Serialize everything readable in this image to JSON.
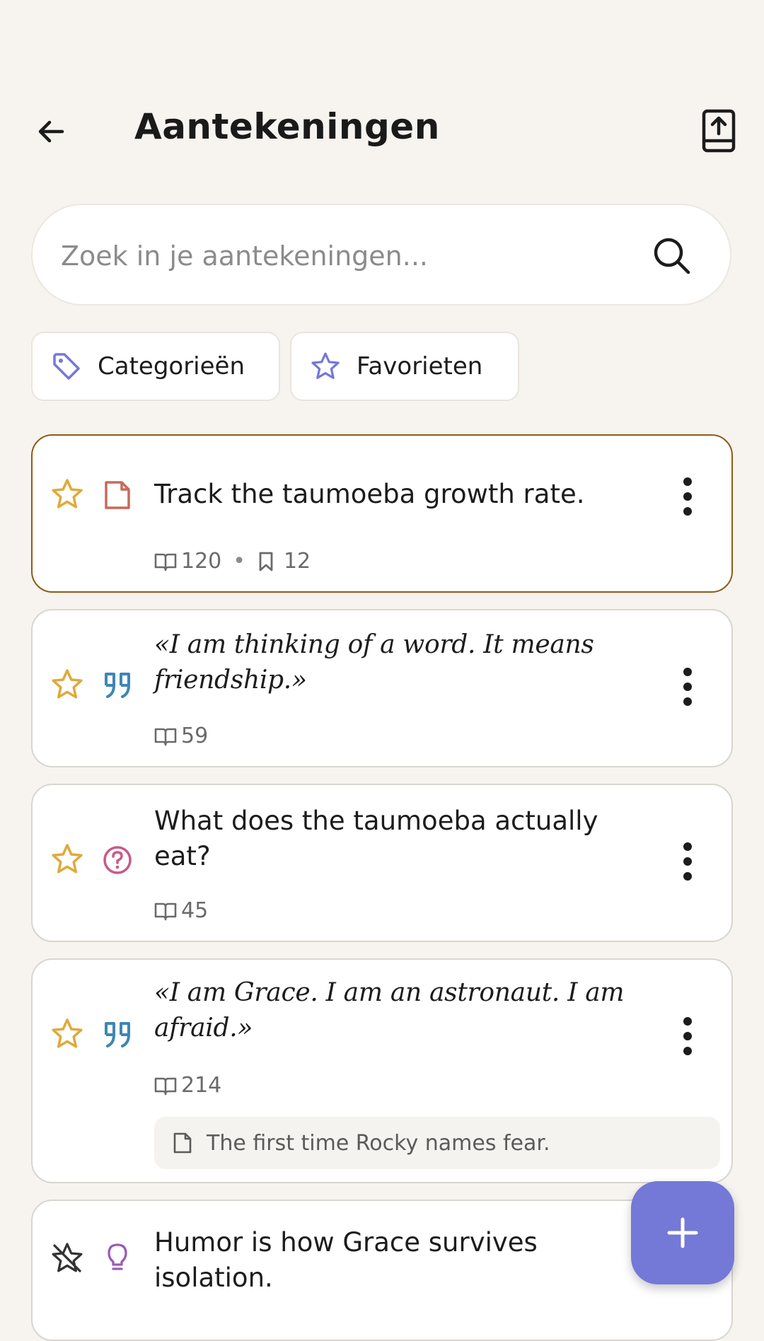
{
  "header": {
    "title": "Aantekeningen",
    "back_icon": "arrow-left-icon",
    "export_icon": "book-upload-icon"
  },
  "search": {
    "placeholder": "Zoek in je aantekeningen...",
    "value": "",
    "icon": "search-icon"
  },
  "filters": [
    {
      "label": "Categorieën",
      "icon": "tag-icon",
      "icon_color": "#7478d7"
    },
    {
      "label": "Favorieten",
      "icon": "star-outline-icon",
      "icon_color": "#7478d7"
    }
  ],
  "notes": [
    {
      "type": "note",
      "type_color": "#c96a5a",
      "favorite": true,
      "text": "Track the taumoeba growth rate.",
      "page": "120",
      "bookmarks": "12",
      "selected": true
    },
    {
      "type": "quote",
      "type_color": "#3e86b5",
      "favorite": true,
      "text": "«I am thinking of a word. It means friendship.»",
      "page": "59"
    },
    {
      "type": "question",
      "type_color": "#c85a8a",
      "favorite": true,
      "text": "What does the taumoeba actually eat?",
      "page": "45"
    },
    {
      "type": "quote",
      "type_color": "#3e86b5",
      "favorite": true,
      "text": "«I am Grace. I am an astronaut. I am afraid.»",
      "page": "214",
      "attached_note": "The first time Rocky names fear."
    },
    {
      "type": "idea",
      "type_color": "#9a5bb5",
      "favorite": false,
      "text": "Humor is how Grace survives isolation."
    }
  ],
  "fab": {
    "icon": "plus-icon",
    "color": "#7478d7"
  },
  "colors": {
    "background": "#f7f3ef",
    "accent": "#7478d7",
    "star": "#e0a93a",
    "selected_border": "#8a5c17"
  }
}
